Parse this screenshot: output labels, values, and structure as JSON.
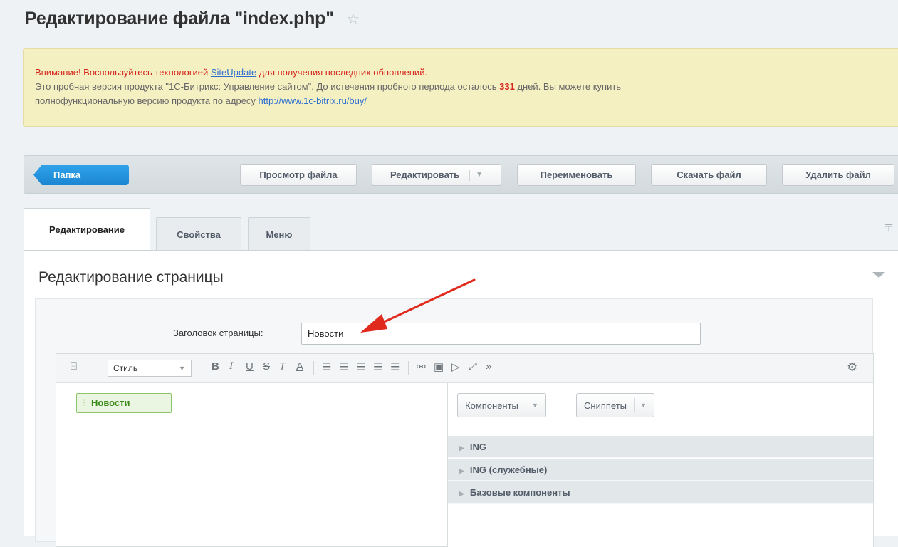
{
  "page": {
    "title": "Редактирование файла \"index.php\""
  },
  "notice": {
    "warning_prefix": "Внимание! Воспользуйтесь технологией ",
    "warning_link": "SiteUpdate",
    "warning_suffix": " для получения последних обновлений.",
    "trial_prefix": "Это пробная версия продукта \"1С-Битрикс: Управление сайтом\". До истечения пробного периода осталось ",
    "days": "331",
    "trial_suffix": " дней. Вы можете купить",
    "trial_line2": "полнофункциональную версию продукта по адресу ",
    "buy_link": "http://www.1c-bitrix.ru/buy/"
  },
  "toolbar": {
    "folder": "Папка",
    "view": "Просмотр файла",
    "edit": "Редактировать",
    "rename": "Переименовать",
    "download": "Скачать файл",
    "delete": "Удалить файл"
  },
  "tabs": {
    "edit": "Редактирование",
    "properties": "Свойства",
    "menu": "Меню"
  },
  "section": {
    "title": "Редактирование страницы"
  },
  "form": {
    "title_label": "Заголовок страницы:",
    "title_value": "Новости"
  },
  "editor": {
    "style_select": "Стиль",
    "content_title": "Новости",
    "components_button": "Компоненты",
    "snippets_button": "Сниппеты",
    "groups": [
      "ING",
      "ING (служебные)",
      "Базовые компоненты"
    ]
  },
  "colors": {
    "accent_blue": "#1b86d3",
    "warning_red": "#d5271f",
    "notice_bg": "#f5f0c2",
    "annotation_arrow": "#e02a1d"
  }
}
